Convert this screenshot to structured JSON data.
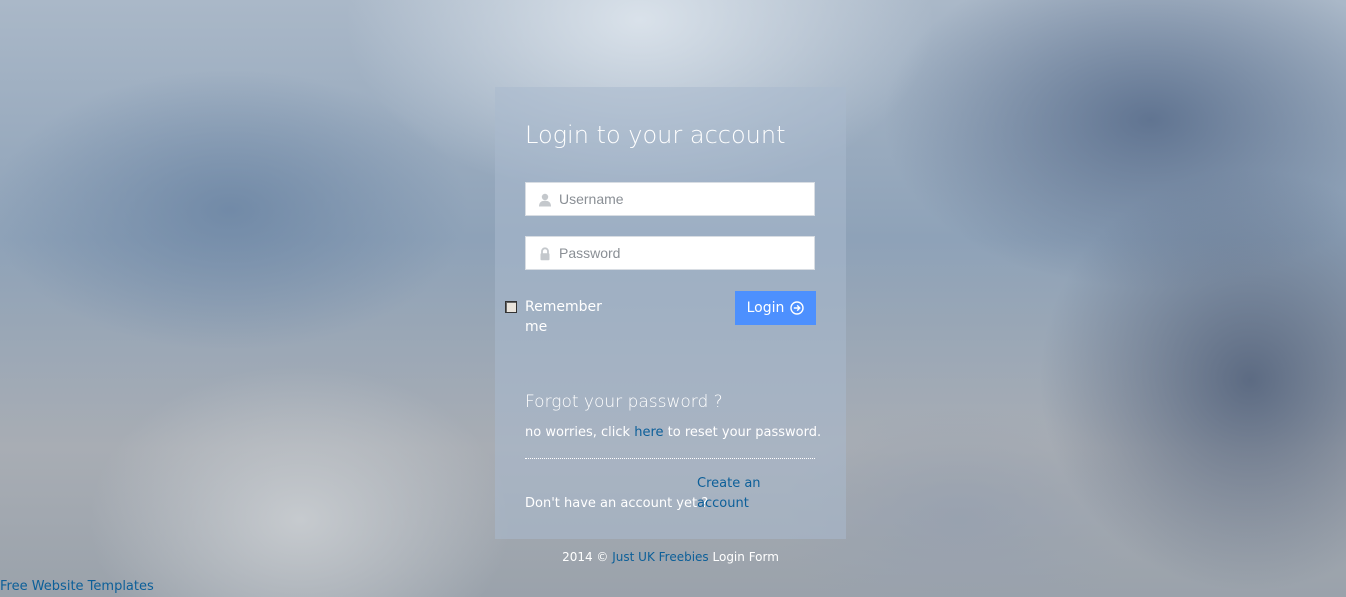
{
  "login_panel": {
    "title": "Login to your account",
    "username": {
      "placeholder": "Username",
      "value": ""
    },
    "password": {
      "placeholder": "Password",
      "value": ""
    },
    "remember_label": "Remember me",
    "remember_checked": false,
    "login_button_label": "Login",
    "forgot_title": "Forgot your password ?",
    "forgot_text_before": "no worries, click ",
    "forgot_link": "here",
    "forgot_text_after": " to reset your password.",
    "no_account_text": "Don't have an account yet ?",
    "create_account_link": "Create an account"
  },
  "footer": {
    "prefix": "2014 © ",
    "link": "Just UK Freebies",
    "suffix": " Login Form"
  },
  "bottom_link": "Free Website Templates",
  "colors": {
    "accent_button": "#4d90fe",
    "link": "#0c5f99",
    "text": "#ffffff"
  },
  "icons": {
    "username": "user-icon",
    "password": "lock-icon",
    "login_button": "circle-arrow-right-icon"
  }
}
